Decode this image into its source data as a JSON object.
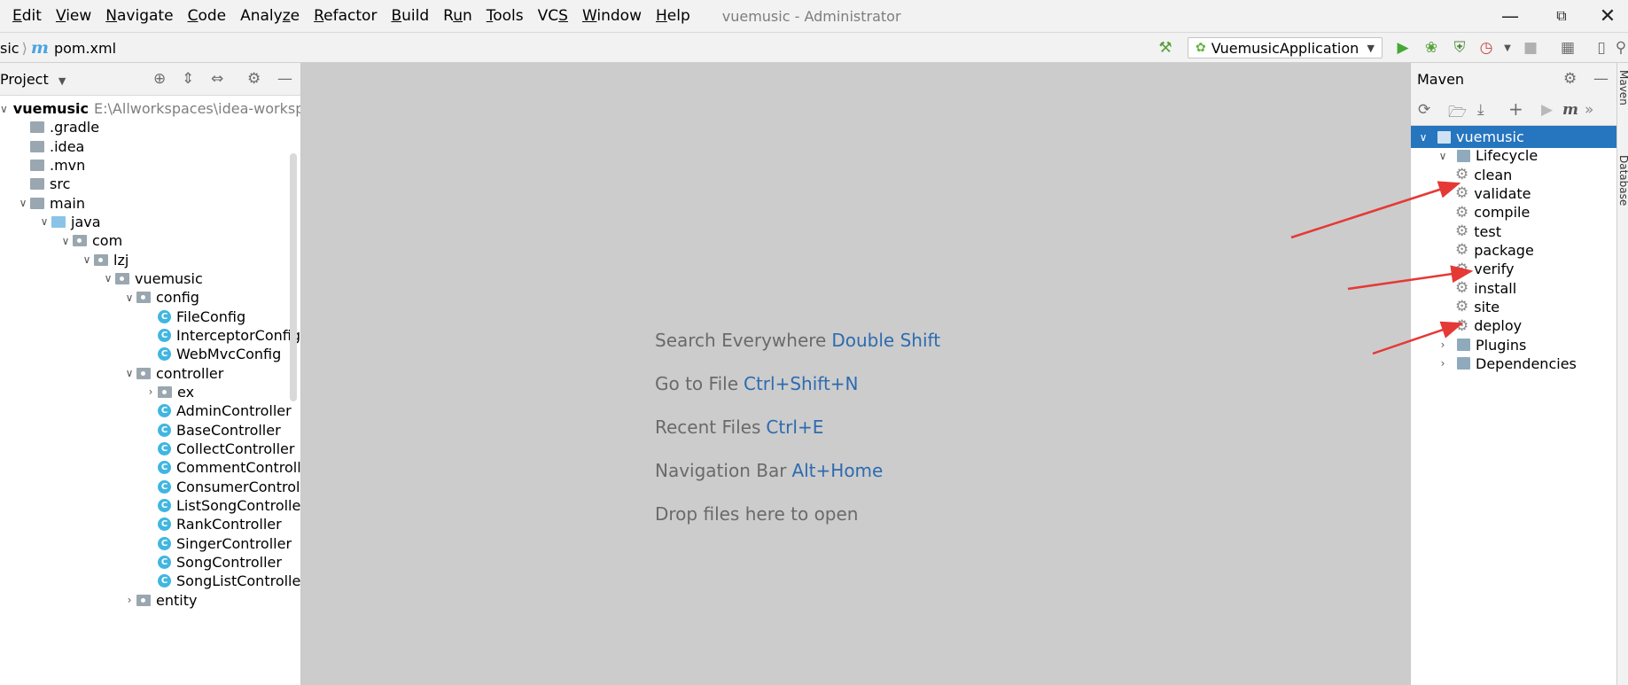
{
  "menu": {
    "items": [
      {
        "mn": "E",
        "rest": "dit"
      },
      {
        "mn": "V",
        "rest": "iew"
      },
      {
        "mn": "N",
        "rest": "avigate"
      },
      {
        "mn": "C",
        "rest": "ode"
      },
      {
        "mn": "",
        "rest": "Analy",
        "mn2": "z",
        "rest2": "e"
      },
      {
        "mn": "R",
        "rest": "efactor"
      },
      {
        "mn": "B",
        "rest": "uild"
      },
      {
        "mn": "",
        "rest": "R",
        "mn2": "u",
        "rest2": "n"
      },
      {
        "mn": "T",
        "rest": "ools"
      },
      {
        "mn": "",
        "rest": "VC",
        "mn2": "S",
        "rest2": ""
      },
      {
        "mn": "W",
        "rest": "indow"
      },
      {
        "mn": "H",
        "rest": "elp"
      }
    ],
    "window_title": "vuemusic - Administrator"
  },
  "nav": {
    "crumb_project": "sic",
    "crumb_file": "pom.xml",
    "run_config": "VuemusicApplication"
  },
  "project": {
    "title": "Project",
    "tree": [
      {
        "depth": 0,
        "arrow": "down",
        "icon": "",
        "label": "vuemusic",
        "extra": "E:\\Allworkspaces\\idea-workspace\\",
        "bold": true
      },
      {
        "depth": 1,
        "arrow": "",
        "icon": "folder",
        "label": ".gradle"
      },
      {
        "depth": 1,
        "arrow": "",
        "icon": "folder",
        "label": ".idea"
      },
      {
        "depth": 1,
        "arrow": "",
        "icon": "folder",
        "label": ".mvn"
      },
      {
        "depth": 1,
        "arrow": "",
        "icon": "folder",
        "label": "src"
      },
      {
        "depth": 1,
        "arrow": "down",
        "icon": "folder",
        "label": "main"
      },
      {
        "depth": 2,
        "arrow": "down",
        "icon": "src",
        "label": "java"
      },
      {
        "depth": 3,
        "arrow": "down",
        "icon": "pkg",
        "label": "com"
      },
      {
        "depth": 4,
        "arrow": "down",
        "icon": "pkg",
        "label": "lzj"
      },
      {
        "depth": 5,
        "arrow": "down",
        "icon": "pkg",
        "label": "vuemusic"
      },
      {
        "depth": 6,
        "arrow": "down",
        "icon": "pkg",
        "label": "config"
      },
      {
        "depth": 7,
        "arrow": "",
        "icon": "class",
        "label": "FileConfig"
      },
      {
        "depth": 7,
        "arrow": "",
        "icon": "class",
        "label": "InterceptorConfig"
      },
      {
        "depth": 7,
        "arrow": "",
        "icon": "class",
        "label": "WebMvcConfig"
      },
      {
        "depth": 6,
        "arrow": "down",
        "icon": "pkg",
        "label": "controller"
      },
      {
        "depth": 7,
        "arrow": "right",
        "icon": "pkg",
        "label": "ex"
      },
      {
        "depth": 7,
        "arrow": "",
        "icon": "class",
        "label": "AdminController"
      },
      {
        "depth": 7,
        "arrow": "",
        "icon": "class",
        "label": "BaseController"
      },
      {
        "depth": 7,
        "arrow": "",
        "icon": "class",
        "label": "CollectController"
      },
      {
        "depth": 7,
        "arrow": "",
        "icon": "class",
        "label": "CommentController"
      },
      {
        "depth": 7,
        "arrow": "",
        "icon": "class",
        "label": "ConsumerController"
      },
      {
        "depth": 7,
        "arrow": "",
        "icon": "class",
        "label": "ListSongController"
      },
      {
        "depth": 7,
        "arrow": "",
        "icon": "class",
        "label": "RankController"
      },
      {
        "depth": 7,
        "arrow": "",
        "icon": "class",
        "label": "SingerController"
      },
      {
        "depth": 7,
        "arrow": "",
        "icon": "class",
        "label": "SongController"
      },
      {
        "depth": 7,
        "arrow": "",
        "icon": "class",
        "label": "SongListController"
      },
      {
        "depth": 6,
        "arrow": "right",
        "icon": "pkg",
        "label": "entity"
      }
    ]
  },
  "editor": {
    "hints": [
      {
        "text": "Search Everywhere",
        "key": "Double Shift"
      },
      {
        "text": "Go to File",
        "key": "Ctrl+Shift+N"
      },
      {
        "text": "Recent Files",
        "key": "Ctrl+E"
      },
      {
        "text": "Navigation Bar",
        "key": "Alt+Home"
      },
      {
        "text": "Drop files here to open",
        "key": ""
      }
    ]
  },
  "maven": {
    "title": "Maven",
    "tree": [
      {
        "depth": 0,
        "arrow": "down",
        "icon": "maven",
        "label": "vuemusic",
        "selected": true
      },
      {
        "depth": 1,
        "arrow": "down",
        "icon": "maven",
        "label": "Lifecycle"
      },
      {
        "depth": 2,
        "arrow": "",
        "icon": "gear",
        "label": "clean"
      },
      {
        "depth": 2,
        "arrow": "",
        "icon": "gear",
        "label": "validate"
      },
      {
        "depth": 2,
        "arrow": "",
        "icon": "gear",
        "label": "compile"
      },
      {
        "depth": 2,
        "arrow": "",
        "icon": "gear",
        "label": "test"
      },
      {
        "depth": 2,
        "arrow": "",
        "icon": "gear",
        "label": "package"
      },
      {
        "depth": 2,
        "arrow": "",
        "icon": "gear",
        "label": "verify"
      },
      {
        "depth": 2,
        "arrow": "",
        "icon": "gear",
        "label": "install"
      },
      {
        "depth": 2,
        "arrow": "",
        "icon": "gear",
        "label": "site"
      },
      {
        "depth": 2,
        "arrow": "",
        "icon": "gear",
        "label": "deploy"
      },
      {
        "depth": 1,
        "arrow": "right",
        "icon": "maven",
        "label": "Plugins"
      },
      {
        "depth": 1,
        "arrow": "right",
        "icon": "maven",
        "label": "Dependencies"
      }
    ]
  },
  "side_tabs": {
    "maven": "Maven",
    "database": "Database"
  },
  "colors": {
    "annotation_arrow": "#e53935",
    "selection": "#2675bf",
    "shortcut": "#2d6bb0"
  }
}
